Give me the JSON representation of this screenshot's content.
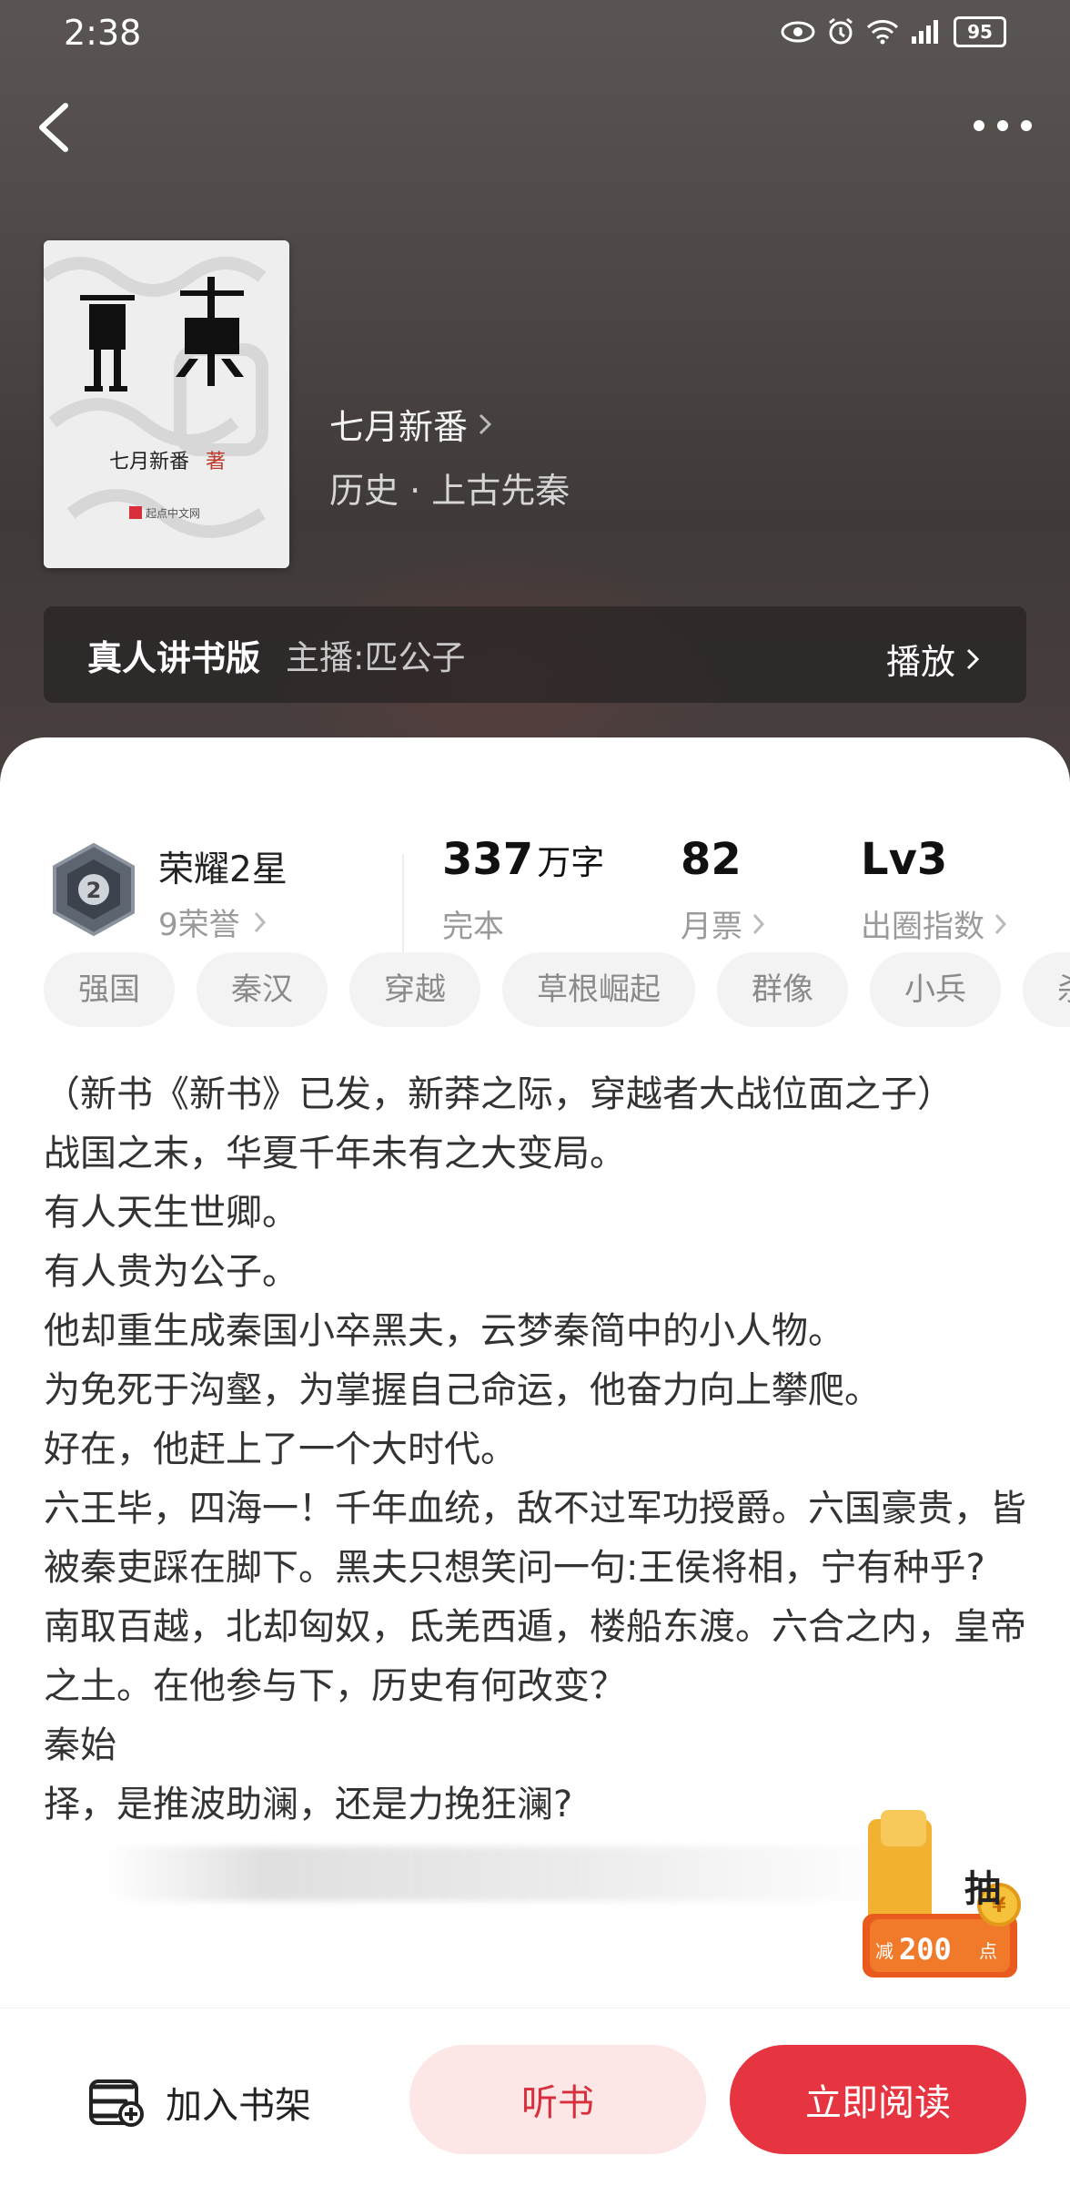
{
  "status_bar": {
    "time": "2:38",
    "battery": "95",
    "network": "4G"
  },
  "book": {
    "author": "七月新番",
    "genre": "历史 · 上古先秦",
    "cover_title": "秦吏",
    "cover_author": "七月新番",
    "cover_author_suffix": "著",
    "cover_publisher": "起点中文网"
  },
  "audio": {
    "title": "真人讲书版",
    "host": "主播:匹公子",
    "play_label": "播放"
  },
  "stats": {
    "honor_title": "荣耀2星",
    "honor_badge_num": "2",
    "honor_sub": "9荣誉",
    "words_value": "337",
    "words_unit": "万字",
    "words_label": "完本",
    "tickets_value": "82",
    "tickets_label": "月票",
    "level_value": "Lv3",
    "level_label": "出圈指数"
  },
  "tags": [
    "强国",
    "秦汉",
    "穿越",
    "草根崛起",
    "群像",
    "小兵",
    "杀"
  ],
  "intro_lines": [
    "（新书《新书》已发，新莽之际，穿越者大战位面之子）",
    "战国之末，华夏千年未有之大变局。",
    "有人天生世卿。",
    "有人贵为公子。",
    "他却重生成秦国小卒黑夫，云梦秦简中的小人物。",
    "为免死于沟壑，为掌握自己命运，他奋力向上攀爬。",
    "好在，他赶上了一个大时代。",
    "六王毕，四海一！千年血统，敌不过军功授爵。六国豪贵，皆被秦吏踩在脚下。黑夫只想笑问一句:王侯将相，宁有种乎?",
    "南取百越，北却匈奴，氐羌西遁，楼船东渡。六合之内，皇帝之土。在他参与下，历史有何改变？",
    "秦始",
    "择，是推波助澜，还是力挽狂澜?"
  ],
  "promo": {
    "char": "抽",
    "prefix": "减",
    "amount": "200",
    "suffix": "点"
  },
  "bottom": {
    "shelf_label": "加入书架",
    "listen_label": "听书",
    "read_label": "立即阅读"
  },
  "colors": {
    "accent": "#e63540",
    "accent_light": "#fde6e6"
  }
}
